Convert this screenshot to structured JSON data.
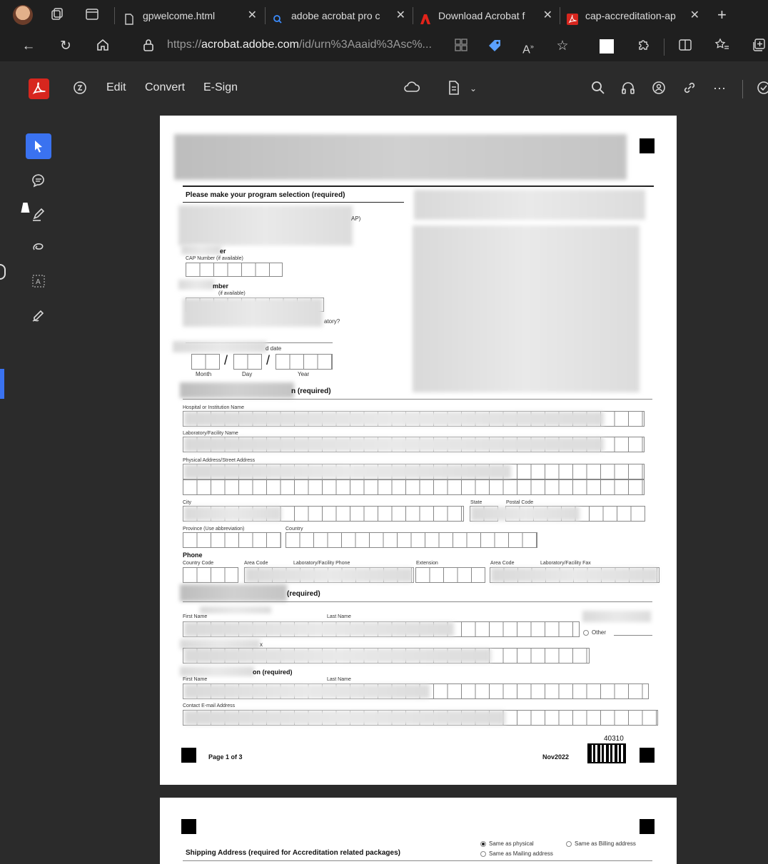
{
  "browser": {
    "tabs": [
      {
        "label": "gpwelcome.html",
        "icon": "page-icon"
      },
      {
        "label": "adobe acrobat pro c",
        "icon": "search-icon"
      },
      {
        "label": "Download Acrobat f",
        "icon": "adobe-icon"
      },
      {
        "label": "cap-accreditation-ap",
        "icon": "acrobat-pdf-icon"
      }
    ],
    "new_tab": "+",
    "url_host": "acrobat.adobe.com",
    "url_scheme": "https://",
    "url_rest": "/id/urn%3Aaaid%3Asc%..."
  },
  "acrobat": {
    "menu": [
      "Edit",
      "Convert",
      "E-Sign"
    ]
  },
  "document": {
    "program_selection": "Please make your program selection (required)",
    "cap_number_label": "CAP Number (if available)",
    "cap_number_label_2": "(if available)",
    "er_frag": "er",
    "mber_frag": "mber",
    "ap_frag": "AP)",
    "atory_frag": "atory?",
    "d_date_frag": "d date",
    "date_month": "Month",
    "date_day": "Day",
    "date_year": "Year",
    "date_sep": "/",
    "section_required": "n (required)",
    "hospital_label": "Hospital or Institution Name",
    "lab_label": "Laboratory/Facility Name",
    "address_label": "Physical Address/Street Address",
    "city_label": "City",
    "state_label": "State",
    "postal_label": "Postal Code",
    "province_label": "Province (Use abbreviation)",
    "country_label": "Country",
    "phone_heading": "Phone",
    "country_code_label": "Country Code",
    "area_code_label": "Area Code",
    "lab_phone_label": "Laboratory/Facility Phone",
    "extension_label": "Extension",
    "area_code_label_2": "Area Code",
    "lab_fax_label": "Laboratory/Facility Fax",
    "contact_required": "(required)",
    "first_name_label": "First Name",
    "last_name_label": "Last Name",
    "other_label": "Other",
    "x_frag": "x",
    "on_required": "on (required)",
    "first_name_label_2": "First Name",
    "last_name_label_2": "Last Name",
    "contact_email_label": "Contact E-mail Address",
    "form_number": "40310",
    "page_label": "Page 1 of 3",
    "edition": "Nov2022",
    "shipping_heading": "Shipping Address (required for Accreditation related packages)",
    "same_as_physical": "Same as physical",
    "same_as_mailing": "Same as Mailing address",
    "same_as_billing": "Same as Billing address"
  }
}
